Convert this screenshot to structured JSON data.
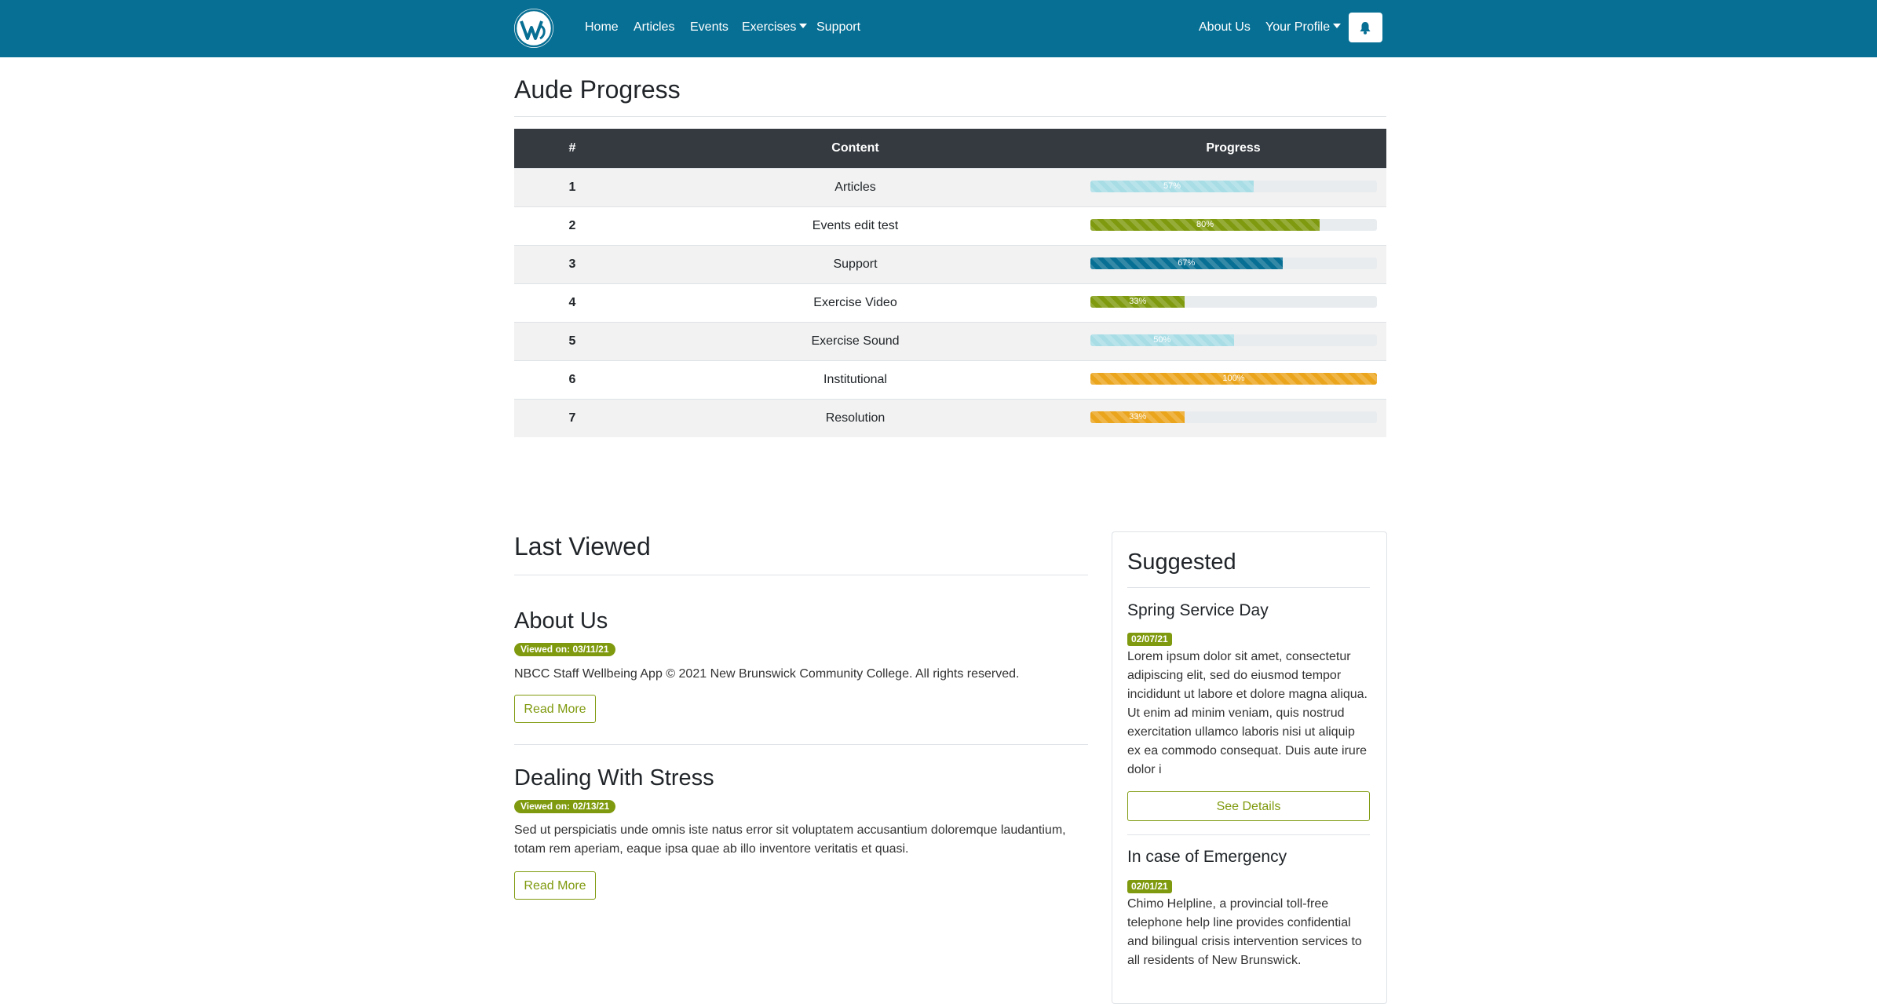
{
  "nav": {
    "links": [
      "Home",
      "Articles",
      "Events",
      "Exercises",
      "Support"
    ],
    "right_links": [
      "About Us",
      "Your Profile"
    ],
    "logo_icon": "wordpress-logo-icon",
    "bell_icon": "bell-icon"
  },
  "colors": {
    "navbar": "#076f94",
    "accent_green": "#7f9a0e",
    "info": "#a8dde6",
    "warning": "#eba51d",
    "table_header": "#343a40"
  },
  "progress": {
    "title": "Aude Progress",
    "headers": [
      "#",
      "Content",
      "Progress"
    ],
    "rows": [
      {
        "num": "1",
        "content": "Articles",
        "percent": 57,
        "label": "57%",
        "color": "#a8dde6"
      },
      {
        "num": "2",
        "content": "Events edit test",
        "percent": 80,
        "label": "80%",
        "color": "#7f9a0e"
      },
      {
        "num": "3",
        "content": "Support",
        "percent": 67,
        "label": "67%",
        "color": "#076f94"
      },
      {
        "num": "4",
        "content": "Exercise Video",
        "percent": 33,
        "label": "33%",
        "color": "#7f9a0e"
      },
      {
        "num": "5",
        "content": "Exercise Sound",
        "percent": 50,
        "label": "50%",
        "color": "#a8dde6"
      },
      {
        "num": "6",
        "content": "Institutional",
        "percent": 100,
        "label": "100%",
        "color": "#eba51d"
      },
      {
        "num": "7",
        "content": "Resolution",
        "percent": 33,
        "label": "33%",
        "color": "#eba51d"
      }
    ]
  },
  "last_viewed": {
    "title": "Last Viewed",
    "items": [
      {
        "title": "About Us",
        "badge": "Viewed on: 03/11/21",
        "text": "NBCC Staff Wellbeing App © 2021 New Brunswick Community College. All rights reserved.",
        "button": "Read More"
      },
      {
        "title": "Dealing With Stress",
        "badge": "Viewed on: 02/13/21",
        "text": "Sed ut perspiciatis unde omnis iste natus error sit voluptatem accusantium doloremque laudantium, totam rem aperiam, eaque ipsa quae ab illo inventore veritatis et quasi.",
        "button": "Read More"
      }
    ]
  },
  "suggested": {
    "title": "Suggested",
    "items": [
      {
        "title": "Spring Service Day",
        "badge": "02/07/21",
        "text": "Lorem ipsum dolor sit amet, consectetur adipiscing elit, sed do eiusmod tempor incididunt ut labore et dolore magna aliqua. Ut enim ad minim veniam, quis nostrud exercitation ullamco laboris nisi ut aliquip ex ea commodo consequat. Duis aute irure dolor i",
        "button": "See Details"
      },
      {
        "title": "In case of Emergency",
        "badge": "02/01/21",
        "text": "Chimo Helpline, a provincial toll-free telephone help line provides confidential and bilingual crisis intervention services to all residents of New Brunswick."
      }
    ]
  }
}
